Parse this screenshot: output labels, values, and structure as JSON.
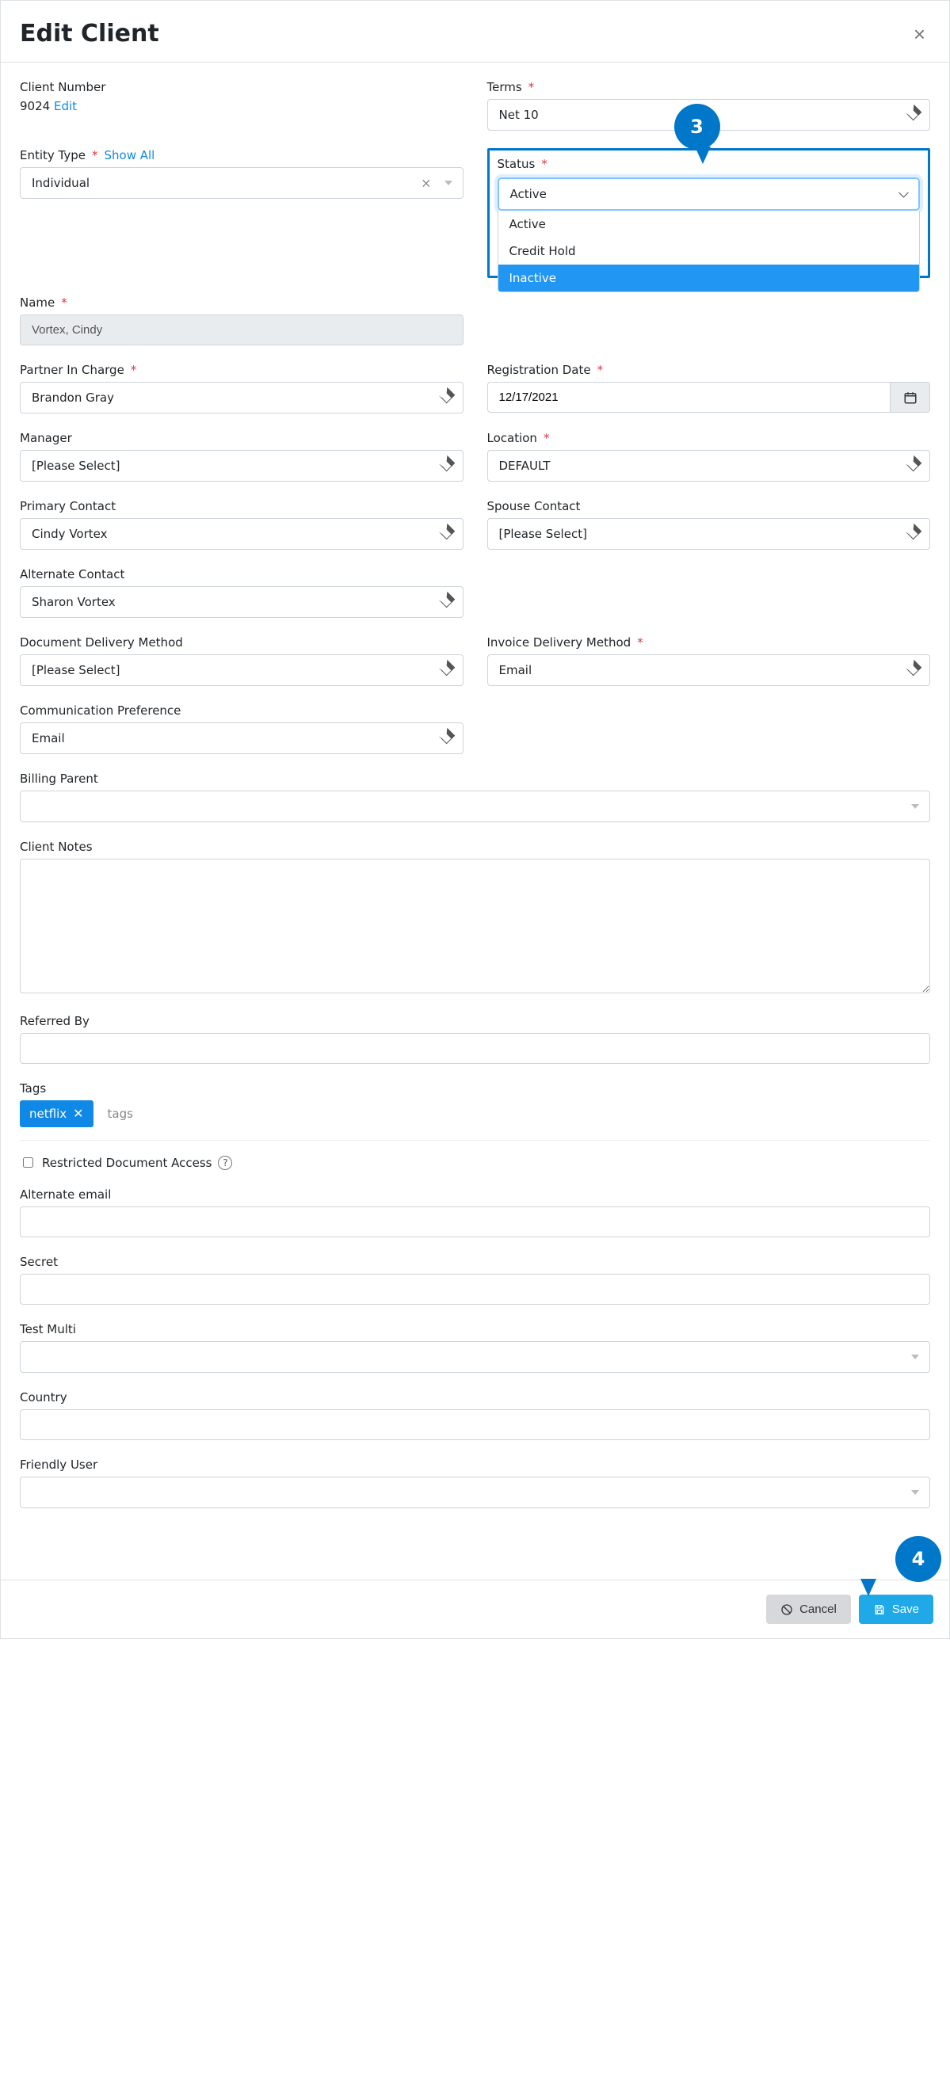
{
  "dialog": {
    "title": "Edit Client"
  },
  "callouts": {
    "c3": "3",
    "c4": "4"
  },
  "left": {
    "client_number_label": "Client Number",
    "client_number_value": "9024",
    "client_number_edit": "Edit",
    "entity_type_label": "Entity Type",
    "entity_type_showall": "Show All",
    "entity_type_value": "Individual",
    "name_label": "Name",
    "name_value": "Vortex, Cindy",
    "partner_label": "Partner In Charge",
    "partner_value": "Brandon Gray",
    "manager_label": "Manager",
    "manager_value": "[Please Select]",
    "primary_contact_label": "Primary Contact",
    "primary_contact_value": "Cindy Vortex",
    "alternate_contact_label": "Alternate Contact",
    "alternate_contact_value": "Sharon Vortex",
    "doc_delivery_label": "Document Delivery Method",
    "doc_delivery_value": "[Please Select]",
    "comm_pref_label": "Communication Preference",
    "comm_pref_value": "Email"
  },
  "right": {
    "terms_label": "Terms",
    "terms_value": "Net 10",
    "status_label": "Status",
    "status_current": "Active",
    "status_options": {
      "o0": "Active",
      "o1": "Credit Hold",
      "o2": "Inactive"
    },
    "reg_date_label": "Registration Date",
    "reg_date_value": "12/17/2021",
    "location_label": "Location",
    "location_value": "DEFAULT",
    "spouse_label": "Spouse Contact",
    "spouse_value": "[Please Select]",
    "inv_delivery_label": "Invoice Delivery Method",
    "inv_delivery_value": "Email"
  },
  "full": {
    "billing_parent_label": "Billing Parent",
    "client_notes_label": "Client Notes",
    "referred_by_label": "Referred By",
    "tags_label": "Tags",
    "tag_value": "netflix",
    "tags_placeholder": "tags",
    "restricted_label": "Restricted Document Access",
    "alt_email_label": "Alternate email",
    "secret_label": "Secret",
    "test_multi_label": "Test Multi",
    "country_label": "Country",
    "friendly_user_label": "Friendly User"
  },
  "footer": {
    "cancel": "Cancel",
    "save": "Save"
  }
}
